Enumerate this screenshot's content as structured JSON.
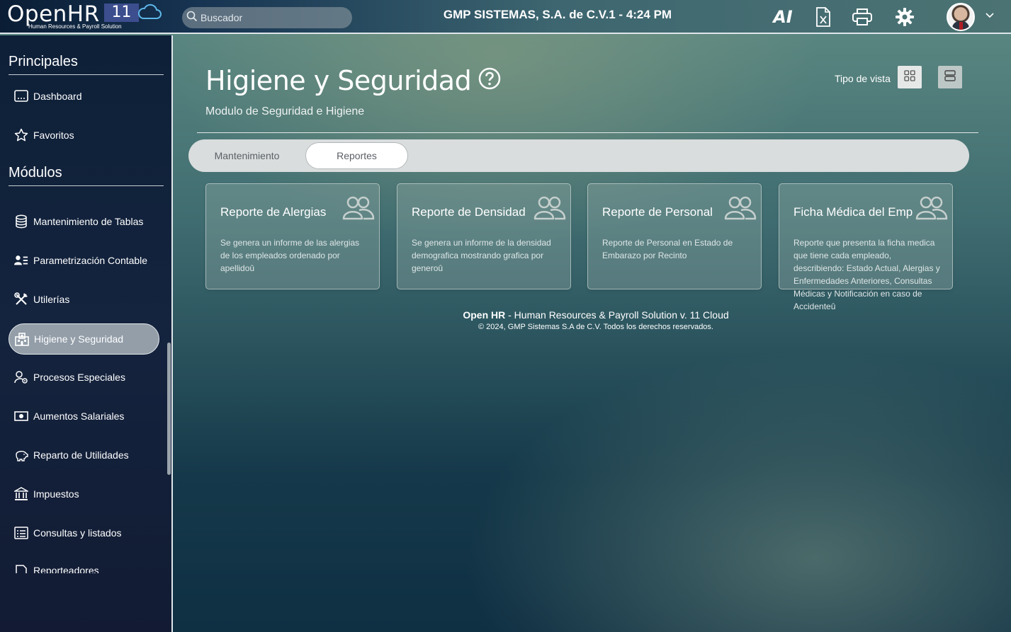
{
  "header": {
    "logo_name": "OpenHR",
    "logo_version": "11",
    "logo_tagline": "Human Resources & Payroll Solution",
    "search_placeholder": "Buscador",
    "company_time": "GMP SISTEMAS, S.A. de C.V.1 - 4:24 PM",
    "ai_label": "AI",
    "icons": [
      "ai-icon",
      "excel-icon",
      "printer-icon",
      "gear-icon",
      "avatar",
      "chevron-down-icon"
    ]
  },
  "sidebar": {
    "principales_title": "Principales",
    "principales": [
      {
        "label": "Dashboard",
        "icon": "dashboard-icon"
      },
      {
        "label": "Favoritos",
        "icon": "star-icon"
      }
    ],
    "modulos_title": "Módulos",
    "modulos": [
      {
        "label": "Mantenimiento de Tablas",
        "icon": "database-icon"
      },
      {
        "label": "Parametrización Contable",
        "icon": "user-list-icon"
      },
      {
        "label": "Utilerías",
        "icon": "tools-icon"
      },
      {
        "label": "Higiene y Seguridad",
        "icon": "hospital-icon",
        "active": true
      },
      {
        "label": "Procesos Especiales",
        "icon": "user-gear-icon"
      },
      {
        "label": "Aumentos Salariales",
        "icon": "money-icon"
      },
      {
        "label": "Reparto de Utilidades",
        "icon": "piggy-bank-icon"
      },
      {
        "label": "Impuestos",
        "icon": "bank-icon"
      },
      {
        "label": "Consultas y listados",
        "icon": "list-icon"
      },
      {
        "label": "Reporteadores",
        "icon": "file-icon"
      }
    ]
  },
  "main": {
    "title": "Higiene y Seguridad",
    "subtitle": "Modulo de Seguridad e Higiene",
    "view_label": "Tipo de vista",
    "tabs": [
      {
        "label": "Mantenimiento",
        "active": false
      },
      {
        "label": "Reportes",
        "active": true
      }
    ],
    "cards": [
      {
        "title": "Reporte de Alergias",
        "description": "Se genera un informe de las alergias de los empleados ordenado por apellidoû"
      },
      {
        "title": "Reporte de Densidad",
        "description": "Se genera un informe de la densidad demografica mostrando grafica por generoû"
      },
      {
        "title": "Reporte de Personal",
        "description": "Reporte de Personal en Estado de Embarazo por Recinto"
      },
      {
        "title": "Ficha Médica del Emp",
        "description": "Reporte que presenta la ficha medica que tiene cada empleado, describiendo: Estado Actual, Alergias y Enfermedades Anteriores, Consultas Médicas y Notificación en caso de Accidenteû"
      }
    ]
  },
  "footer": {
    "brand": "Open HR",
    "product": " - Human Resources & Payroll Solution v. 11 Cloud",
    "copyright": "© 2024, GMP Sistemas S.A de C.V. Todos los derechos reservados."
  }
}
